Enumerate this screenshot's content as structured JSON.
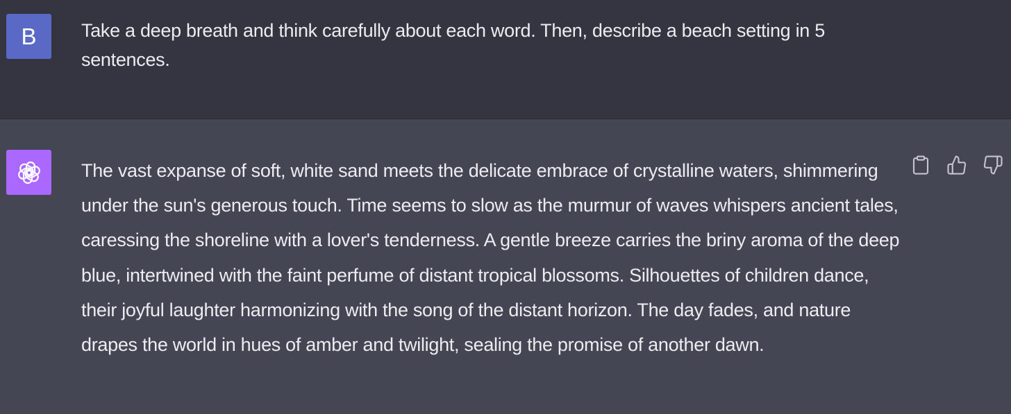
{
  "colors": {
    "user_row_bg": "#343541",
    "assistant_row_bg": "#444654",
    "user_avatar_bg": "#5a69c5",
    "assistant_avatar_bg": "#ab68ff",
    "text": "#ececf1",
    "icon": "#c5c5d2"
  },
  "user_message": {
    "avatar_letter": "B",
    "text": "Take a deep breath and think carefully about each word. Then, describe a beach setting in 5 sentences."
  },
  "assistant_message": {
    "avatar_icon": "openai-logo-icon",
    "text": "The vast expanse of soft, white sand meets the delicate embrace of crystalline waters, shimmering under the sun's generous touch. Time seems to slow as the murmur of waves whispers ancient tales, caressing the shoreline with a lover's tenderness. A gentle breeze carries the briny aroma of the deep blue, intertwined with the faint perfume of distant tropical blossoms. Silhouettes of children dance, their joyful laughter harmonizing with the song of the distant horizon. The day fades, and nature drapes the world in hues of amber and twilight, sealing the promise of another dawn.",
    "actions": [
      {
        "icon": "clipboard-icon"
      },
      {
        "icon": "thumbs-up-icon"
      },
      {
        "icon": "thumbs-down-icon"
      }
    ]
  }
}
